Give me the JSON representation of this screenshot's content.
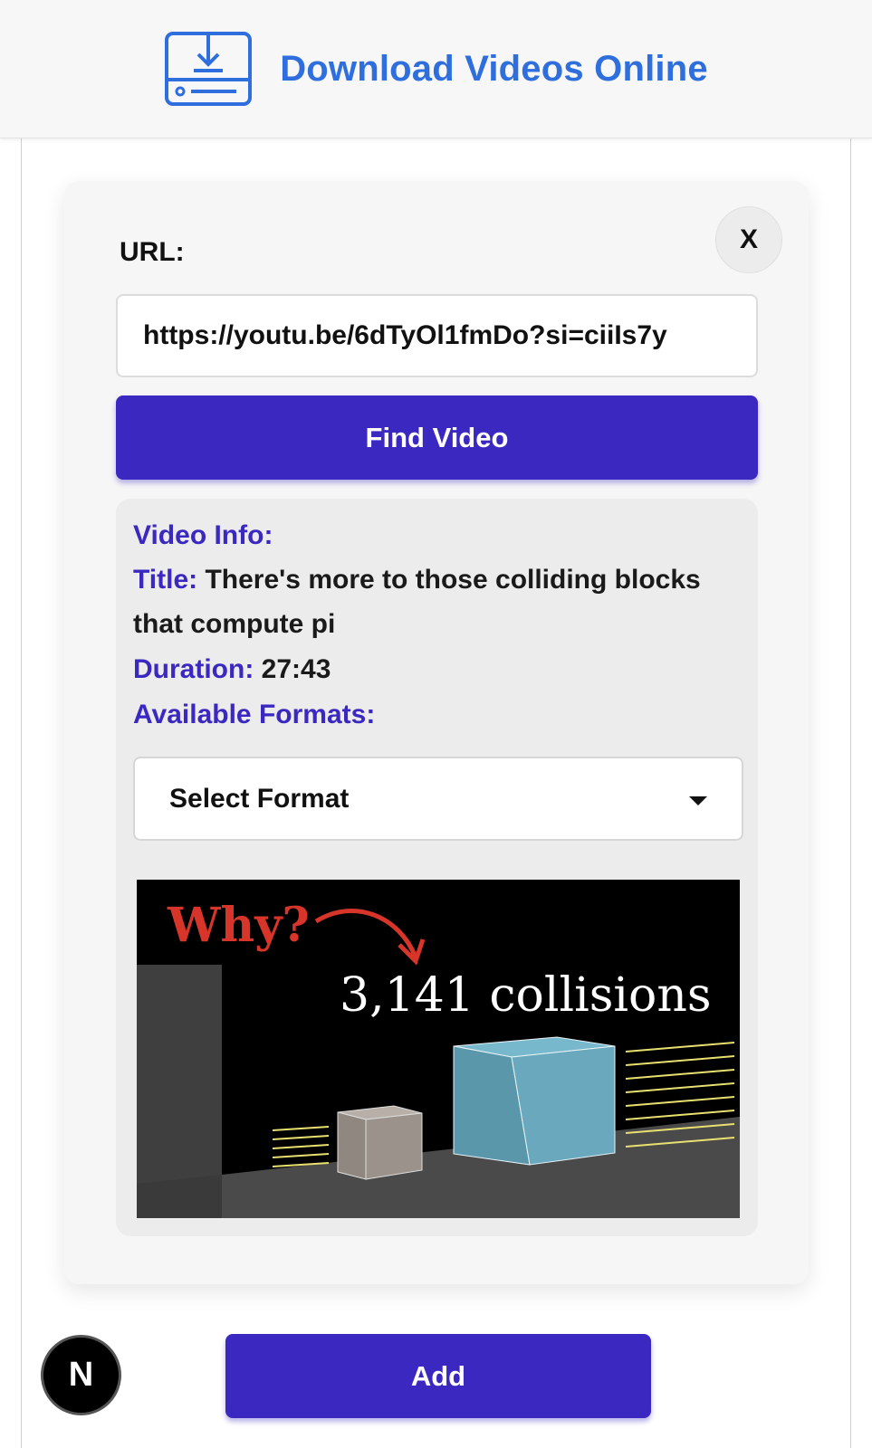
{
  "header": {
    "title": "Download Videos Online",
    "icon": "download-icon",
    "accent_color": "#2f6fdd"
  },
  "form": {
    "close_label": "X",
    "url_label": "URL:",
    "url_value": "https://youtu.be/6dTyOl1fmDo?si=ciiIs7y",
    "find_button": "Find Video"
  },
  "video_info": {
    "heading": "Video Info:",
    "title_label": "Title:",
    "title_value": "There's more to those colliding blocks that compute pi",
    "duration_label": "Duration:",
    "duration_value": "27:43",
    "formats_label": "Available Formats:",
    "format_select": "Select Format",
    "thumbnail": {
      "question": "Why?",
      "caption": "3,141  collisions"
    }
  },
  "footer": {
    "add_button": "Add",
    "badge": "N"
  },
  "colors": {
    "primary_button": "#3a28c0",
    "label_accent": "#3a28c0"
  }
}
